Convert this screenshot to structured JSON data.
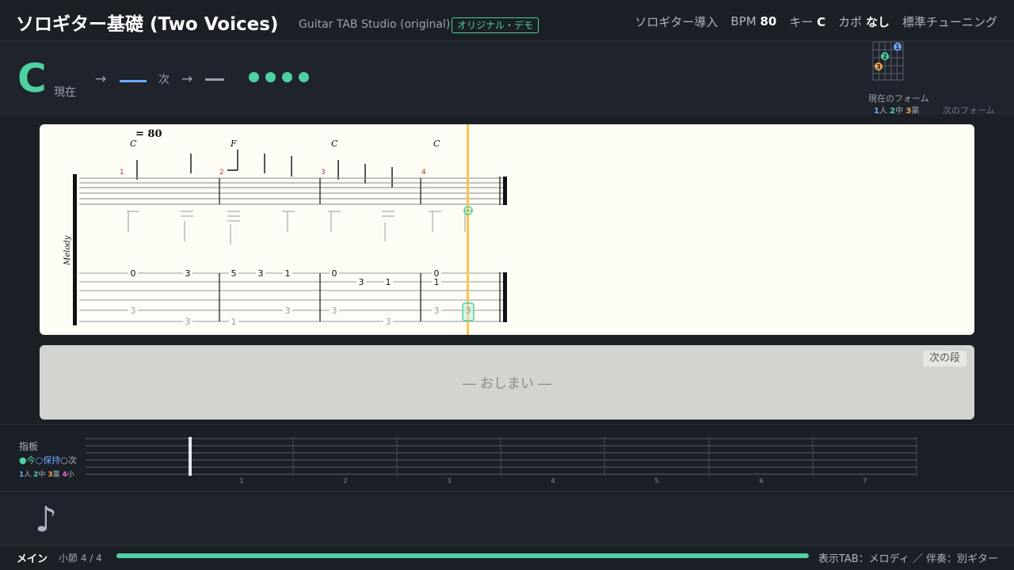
{
  "header": {
    "title": "ソロギター基礎 (Two Voices)",
    "subtitle": "Guitar TAB Studio (original)",
    "badge": "オリジナル・デモ",
    "lesson": "ソロギター導入",
    "bpm_label": "BPM",
    "bpm_value": "80",
    "key_label": "キー",
    "key_value": "C",
    "capo_label": "カポ",
    "capo_value": "なし",
    "tuning": "標準チューニング"
  },
  "chord_bar": {
    "current_chord": "C",
    "current_label": "現在",
    "arrow": "→",
    "next_label": "次",
    "beat_count": 4,
    "colors": {
      "accent": "#4fd1a1",
      "current_line": "#6ea8fe",
      "next_line": "#9aa3ad"
    },
    "form_current_label": "現在のフォーム",
    "form_next_label": "次のフォーム",
    "form_fingers": [
      {
        "num": "1",
        "label": "人"
      },
      {
        "num": "2",
        "label": "中"
      },
      {
        "num": "3",
        "label": "薬"
      }
    ]
  },
  "score": {
    "tempo": "= 80",
    "track_name": "Melody",
    "chords": [
      "C",
      "F",
      "C",
      "C"
    ],
    "measure_numbers": [
      "1",
      "2",
      "3",
      "4"
    ],
    "tab_measures": [
      {
        "top": [
          {
            "fret": "0",
            "string": 1
          },
          {
            "fret": "3",
            "string": 1
          }
        ],
        "mid": [],
        "bass": [
          {
            "fret": "3",
            "string": 5
          },
          {
            "fret": "3",
            "string": 6
          }
        ]
      },
      {
        "top": [
          {
            "fret": "5",
            "string": 1
          },
          {
            "fret": "3",
            "string": 1
          },
          {
            "fret": "1",
            "string": 1
          }
        ],
        "mid": [],
        "bass": [
          {
            "fret": "1",
            "string": 6
          },
          {
            "fret": "3",
            "string": 5
          }
        ]
      },
      {
        "top": [
          {
            "fret": "0",
            "string": 1
          }
        ],
        "mid": [
          {
            "fret": "3",
            "string": 2
          },
          {
            "fret": "1",
            "string": 2
          }
        ],
        "bass": [
          {
            "fret": "3",
            "string": 5
          },
          {
            "fret": "3",
            "string": 6
          }
        ]
      },
      {
        "top": [
          {
            "fret": "0",
            "string": 1
          }
        ],
        "mid": [
          {
            "fret": "1",
            "string": 2
          }
        ],
        "bass": [
          {
            "fret": "3",
            "string": 5
          },
          {
            "fret": "3",
            "string": 5
          }
        ]
      }
    ]
  },
  "ending": {
    "text": "― おしまい ―",
    "next_section": "次の段"
  },
  "fretboard": {
    "title": "指板",
    "legend_now": "●今",
    "legend_hold": "○保持",
    "legend_next": "○次",
    "finger_legend": [
      {
        "num": "1",
        "label": "人"
      },
      {
        "num": "2",
        "label": "中"
      },
      {
        "num": "3",
        "label": "薬"
      },
      {
        "num": "4",
        "label": "小"
      }
    ],
    "fret_numbers": [
      "1",
      "2",
      "3",
      "4",
      "5",
      "6",
      "7"
    ]
  },
  "bottom": {
    "note_icon": "eighth-note-icon",
    "mode": "メイン",
    "measure_label": "小節 4 / 4",
    "progress": 1.0,
    "display_info": "表示TAB：メロディ ／ 伴奏：別ギター"
  }
}
